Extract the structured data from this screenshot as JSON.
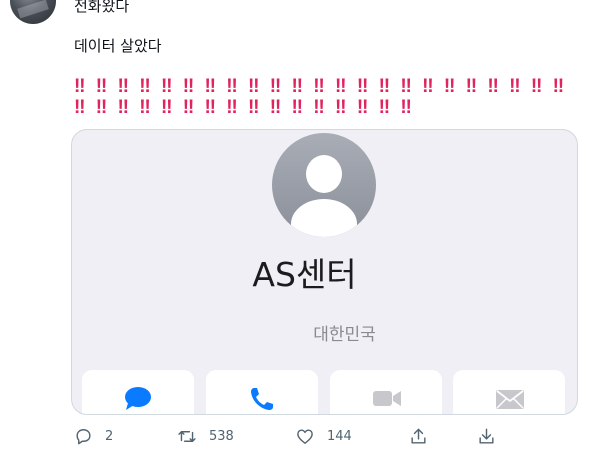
{
  "tweet": {
    "line1": "전화왔다",
    "line2": "데이터 살았다",
    "exclaim_line1": "‼ ‼ ‼ ‼ ‼ ‼ ‼ ‼ ‼ ‼ ‼ ‼ ‼ ‼ ‼ ‼ ‼ ‼ ‼ ‼ ‼ ‼ ‼ ‼",
    "exclaim_line2": "‼ ‼ ‼ ‼ ‼ ‼ ‼ ‼ ‼ ‼ ‼ ‼ ‼ ‼ ‼ ‼"
  },
  "contact_card": {
    "name": "AS센터",
    "country": "대한민국",
    "buttons": [
      "message-icon",
      "phone-icon",
      "video-icon",
      "mail-icon"
    ],
    "accent": "#0a7aff",
    "disabled_icon_color": "#c7c7cc"
  },
  "actions": {
    "reply_count": "2",
    "retweet_count": "538",
    "like_count": "144"
  }
}
